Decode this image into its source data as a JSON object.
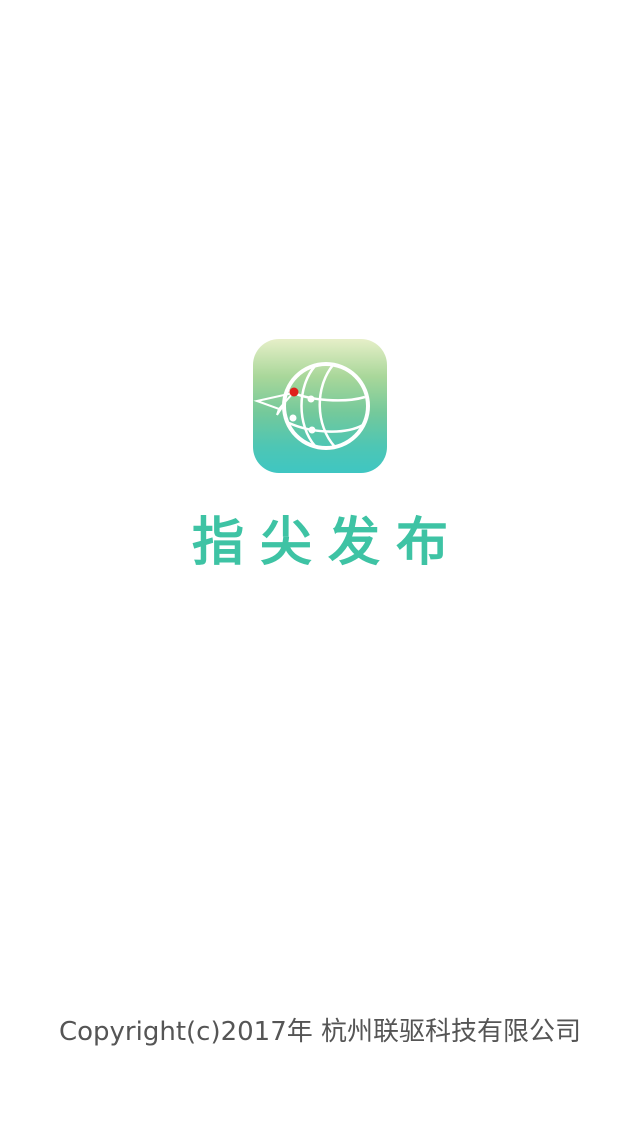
{
  "splash": {
    "app_name": "指尖发布",
    "logo_icon": "globe-paper-plane-icon",
    "copyright": "Copyright(c)2017年 杭州联驱科技有限公司"
  },
  "colors": {
    "brand": "#3ec3a4",
    "icon_gradient_top": "#e6efc8",
    "icon_gradient_bottom": "#3fc6c2",
    "pin_red": "#e0201c",
    "copyright_text": "#555555",
    "background": "#ffffff"
  }
}
